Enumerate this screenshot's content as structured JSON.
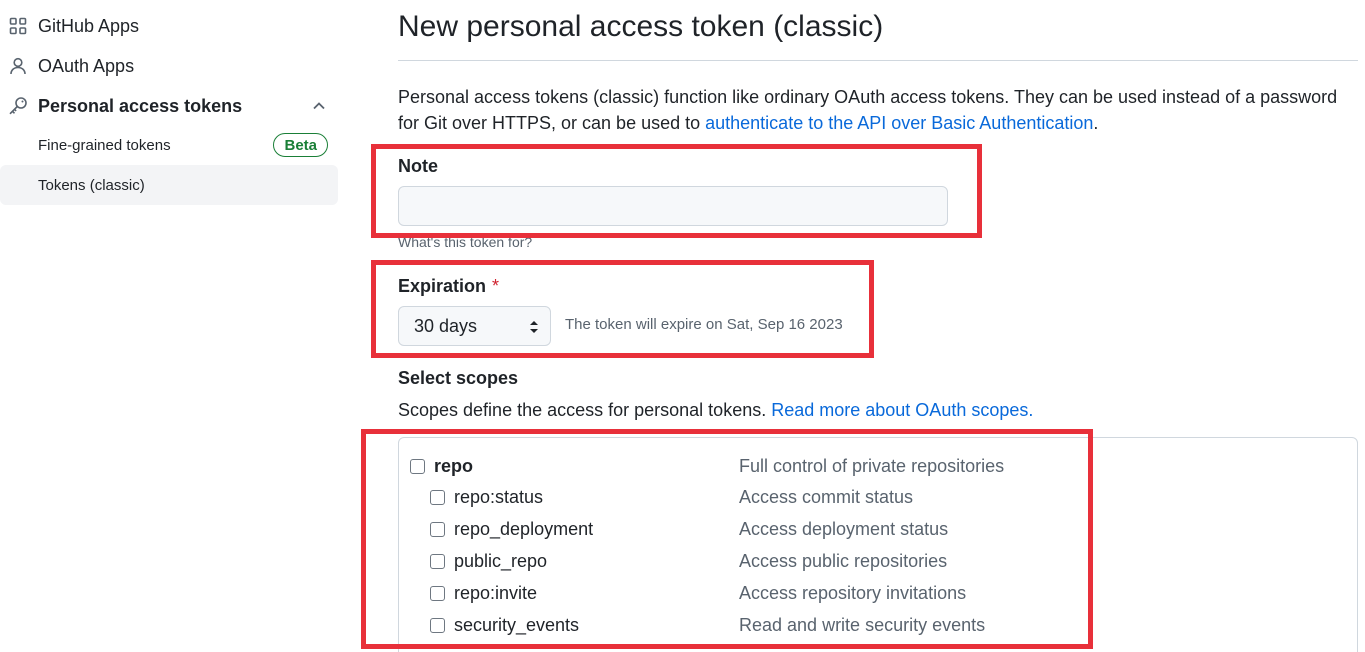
{
  "sidebar": {
    "items": [
      {
        "label": "GitHub Apps",
        "icon": "apps-grid-icon"
      },
      {
        "label": "OAuth Apps",
        "icon": "person-icon"
      },
      {
        "label": "Personal access tokens",
        "icon": "key-icon"
      }
    ],
    "subitems": [
      {
        "label": "Fine-grained tokens",
        "badge": "Beta"
      },
      {
        "label": "Tokens (classic)"
      }
    ]
  },
  "main": {
    "title": "New personal access token (classic)",
    "intro_text": "Personal access tokens (classic) function like ordinary OAuth access tokens. They can be used instead of a password for Git over HTTPS, or can be used to ",
    "intro_link": "authenticate to the API over Basic Authentication",
    "intro_end": ".",
    "note": {
      "label": "Note",
      "value": "",
      "help": "What's this token for?"
    },
    "expiration": {
      "label": "Expiration",
      "required_mark": "*",
      "selected": "30 days",
      "note": "The token will expire on Sat, Sep 16 2023"
    },
    "scopes": {
      "label": "Select scopes",
      "description": "Scopes define the access for personal tokens. ",
      "link": "Read more about OAuth scopes.",
      "items": [
        {
          "name": "repo",
          "desc": "Full control of private repositories"
        },
        {
          "name": "repo:status",
          "desc": "Access commit status"
        },
        {
          "name": "repo_deployment",
          "desc": "Access deployment status"
        },
        {
          "name": "public_repo",
          "desc": "Access public repositories"
        },
        {
          "name": "repo:invite",
          "desc": "Access repository invitations"
        },
        {
          "name": "security_events",
          "desc": "Read and write security events"
        }
      ]
    }
  },
  "colors": {
    "highlight": "#e8303a",
    "link": "#0969da",
    "badge": "#1a7f37",
    "required": "#cf222e"
  }
}
